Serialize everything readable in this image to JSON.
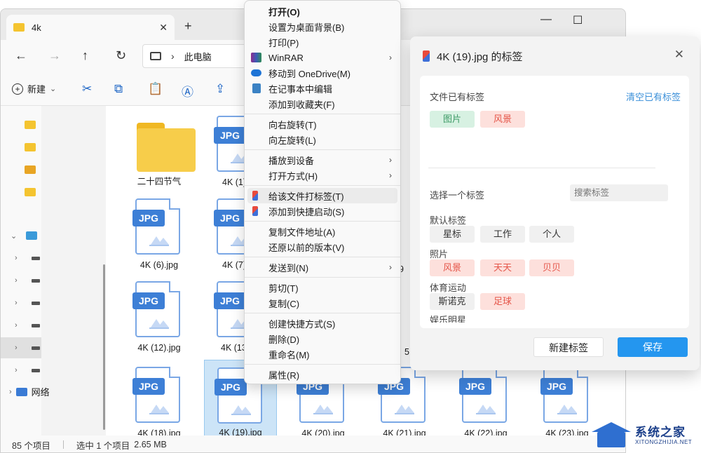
{
  "window": {
    "tab_label": "4k",
    "tab_close": "✕",
    "new_tab": "+",
    "minimize": "—",
    "maximize": "☐",
    "close": "✕"
  },
  "nav": {
    "back": "←",
    "forward": "→",
    "up": "↑",
    "refresh": "↻",
    "address_location": "此电脑",
    "chevron": "›"
  },
  "toolbar": {
    "new_label": "新建",
    "new_caret": "⌄"
  },
  "sidebar": {
    "network_label": "网络"
  },
  "files": [
    {
      "name": "二十四节气",
      "kind": "folder"
    },
    {
      "name": "4K (1).jpg",
      "kind": "jpg"
    },
    {
      "name": "4K (6).jpg",
      "kind": "jpg"
    },
    {
      "name": "4K (7).jpg",
      "kind": "jpg"
    },
    {
      "name": "4K (12).jpg",
      "kind": "jpg"
    },
    {
      "name": "4K (13).jpg",
      "kind": "jpg"
    },
    {
      "name": "4K (18).jpg",
      "kind": "jpg"
    },
    {
      "name": "4K (19).jpg",
      "kind": "jpg"
    },
    {
      "name": "4K (20).jpg",
      "kind": "jpg"
    },
    {
      "name": "4K (21).jpg",
      "kind": "jpg"
    },
    {
      "name": "4K (22).jpg",
      "kind": "jpg"
    },
    {
      "name": "4K (23).jpg",
      "kind": "jpg"
    }
  ],
  "file_label_visible": {
    "f1": "4K (1)",
    "f3": "4K (7)",
    "f5": "4K (13",
    "f9": "9",
    "f5b": "5"
  },
  "jpg_badge": "JPG",
  "status": {
    "count": "85 个项目",
    "selected": "选中 1 个项目",
    "size": "2.65 MB"
  },
  "context_menu": {
    "open": "打开(O)",
    "set_wallpaper": "设置为桌面背景(B)",
    "print": "打印(P)",
    "winrar": "WinRAR",
    "onedrive": "移动到 OneDrive(M)",
    "notepad": "在记事本中编辑",
    "favorites": "添加到收藏夹(F)",
    "rotate_right": "向右旋转(T)",
    "rotate_left": "向左旋转(L)",
    "cast": "播放到设备",
    "open_with": "打开方式(H)",
    "tag_file": "给该文件打标签(T)",
    "quick_launch": "添加到快捷启动(S)",
    "copy_path": "复制文件地址(A)",
    "restore": "还原以前的版本(V)",
    "send_to": "发送到(N)",
    "cut": "剪切(T)",
    "copy": "复制(C)",
    "create_shortcut": "创建快捷方式(S)",
    "delete": "删除(D)",
    "rename": "重命名(M)",
    "properties": "属性(R)",
    "arrow": "›"
  },
  "dialog": {
    "title": "4K (19).jpg 的标签",
    "close": "✕",
    "existing_label": "文件已有标签",
    "clear_link": "清空已有标签",
    "existing_tags": [
      {
        "label": "图片",
        "color": "green"
      },
      {
        "label": "风景",
        "color": "red"
      }
    ],
    "choose_label": "选择一个标签",
    "search_placeholder": "搜索标签",
    "groups": [
      {
        "title": "默认标签",
        "tags": [
          {
            "label": "星标",
            "color": "gray"
          },
          {
            "label": "工作",
            "color": "gray"
          },
          {
            "label": "个人",
            "color": "gray"
          }
        ]
      },
      {
        "title": "照片",
        "tags": [
          {
            "label": "风景",
            "color": "red"
          },
          {
            "label": "天天",
            "color": "red"
          },
          {
            "label": "贝贝",
            "color": "red"
          }
        ]
      },
      {
        "title": "体育运动",
        "tags": [
          {
            "label": "斯诺克",
            "color": "gray"
          },
          {
            "label": "足球",
            "color": "red"
          }
        ]
      },
      {
        "title": "娱乐明星",
        "tags": []
      }
    ],
    "new_tag_button": "新建标签",
    "save_button": "保存"
  },
  "watermark": {
    "cn": "系统之家",
    "en": "XITONGZHIJIA.NET"
  },
  "colors": {
    "accent": "#2496ef",
    "tag_green_bg": "#d7f1e2",
    "tag_red_bg": "#fde0dc",
    "jpg_badge": "#3d7fd6"
  }
}
